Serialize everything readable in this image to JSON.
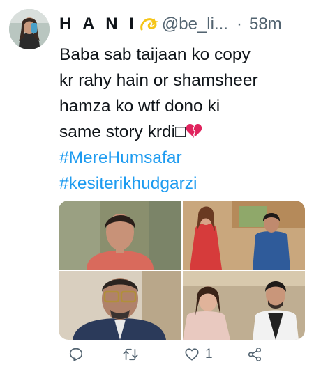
{
  "user": {
    "display_name": "H A N I",
    "name_emoji": "dizzy-emoji",
    "handle": "@be_li...",
    "separator": "·",
    "timestamp": "58m"
  },
  "tweet": {
    "lines": [
      "Baba sab taijaan ko copy",
      "kr rahy hain or shamsheer",
      "hamza ko wtf dono ki",
      "same story krdi"
    ],
    "missing_glyph": "□",
    "end_emoji": "broken-heart-emoji",
    "hashtags": [
      "#MereHumsafar",
      "#kesiterikhudgarzi"
    ]
  },
  "media": {
    "count": 4,
    "items": [
      "photo-woman-closeup",
      "photo-couple-red-dress",
      "photo-man-glasses",
      "photo-couple-closeup"
    ]
  },
  "actions": {
    "reply_icon": "reply-icon",
    "retweet_icon": "retweet-icon",
    "like_icon": "heart-outline-icon",
    "like_count": "1",
    "share_icon": "share-icon"
  },
  "colors": {
    "link": "#1d9bf0",
    "secondary_text": "#536471",
    "primary_text": "#0f1419",
    "broken_heart": "#e0245e",
    "dizzy_emoji": "#f5c518"
  }
}
